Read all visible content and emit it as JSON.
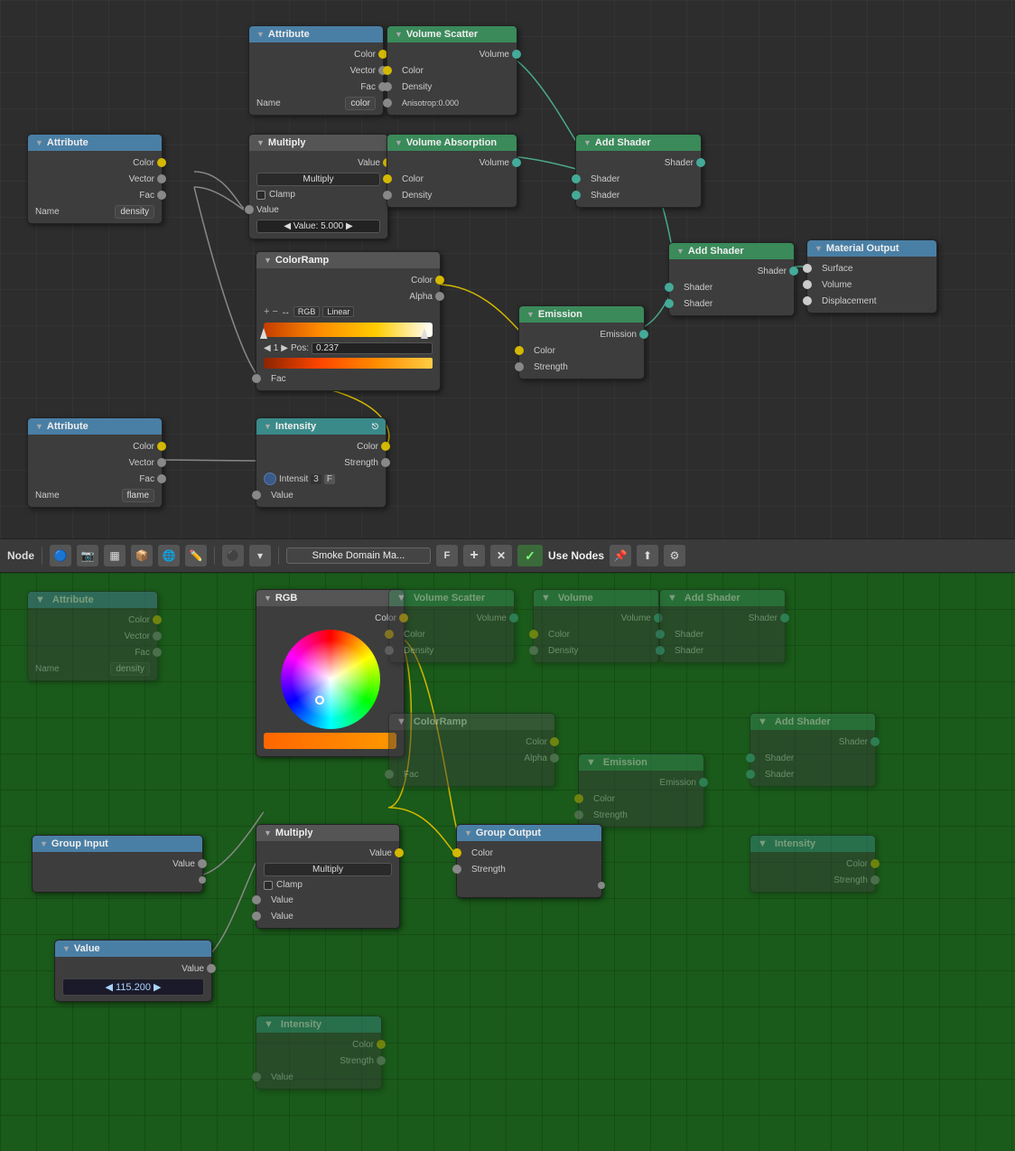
{
  "toolbar": {
    "node_label": "Node",
    "material_name": "Smoke Domain Ma...",
    "use_nodes": "Use Nodes",
    "btn_add": "+",
    "btn_close": "✕",
    "btn_check": "✓",
    "btn_F": "F"
  },
  "top_nodes": {
    "attribute1": {
      "title": "Attribute",
      "name": "color"
    },
    "attribute2": {
      "title": "Attribute",
      "name": "density"
    },
    "attribute3": {
      "title": "Attribute",
      "name": "flame"
    },
    "volume_scatter": {
      "title": "Volume Scatter",
      "anisotropy": "Anisotrop:0.000"
    },
    "volume_absorption": {
      "title": "Volume Absorption"
    },
    "multiply": {
      "title": "Multiply",
      "value": "5.000",
      "mode": "Multiply"
    },
    "colorramp": {
      "title": "ColorRamp",
      "mode": "RGB",
      "interpolation": "Linear",
      "pos": "0.237",
      "stop": "1"
    },
    "add_shader1": {
      "title": "Add Shader"
    },
    "add_shader2": {
      "title": "Add Shader"
    },
    "emission": {
      "title": "Emission"
    },
    "intensity": {
      "title": "Intensity"
    },
    "material_output": {
      "title": "Material Output"
    }
  },
  "bottom_nodes": {
    "rgb": {
      "title": "RGB"
    },
    "multiply": {
      "title": "Multiply",
      "mode": "Multiply"
    },
    "group_input": {
      "title": "Group Input",
      "value": "Value"
    },
    "group_output": {
      "title": "Group Output",
      "color": "Color",
      "strength": "Strength"
    },
    "value_node": {
      "title": "Value",
      "value": "Value",
      "number": "115.200"
    }
  },
  "sockets": {
    "yellow": "#d4b800",
    "gray": "#888888",
    "green": "#4aaa88",
    "white": "#cccccc"
  }
}
